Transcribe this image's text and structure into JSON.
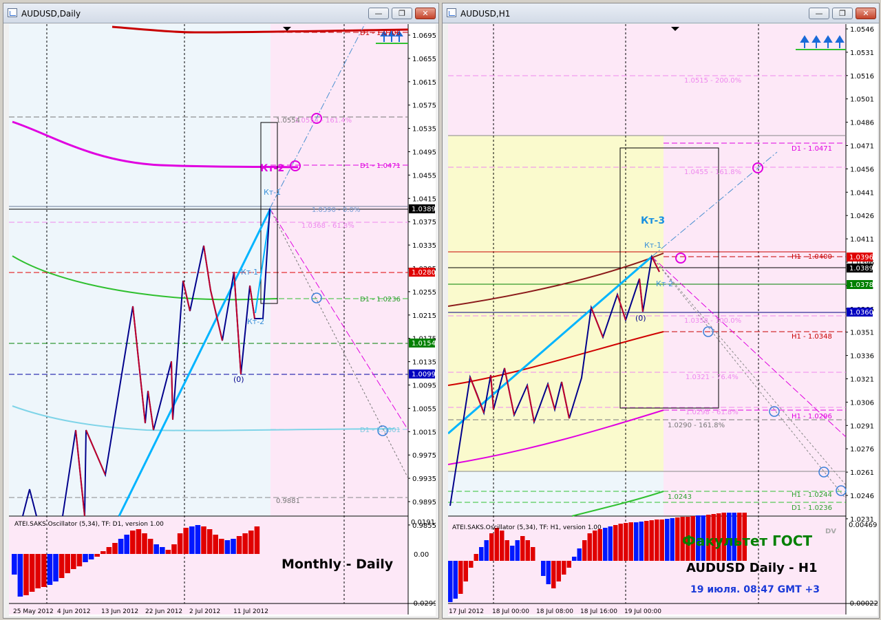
{
  "windows": {
    "left": {
      "title": "AUDUSD,Daily"
    },
    "right": {
      "title": "AUDUSD,H1"
    }
  },
  "controls": {
    "minimize": "—",
    "restore": "❐",
    "close": "✕"
  },
  "left_chart": {
    "price_ticks": [
      "1.0695",
      "1.0655",
      "1.0615",
      "1.0575",
      "1.0535",
      "1.0495",
      "1.0455",
      "1.0415",
      "1.0375",
      "1.0335",
      "1.0295",
      "1.0255",
      "1.0215",
      "1.0175",
      "1.0135",
      "1.0095",
      "1.0055",
      "1.0015",
      "0.9975",
      "0.9935",
      "0.9895",
      "0.9855"
    ],
    "price_boxes": [
      {
        "label": "1.0389",
        "color": "#000000"
      },
      {
        "label": "1.0280",
        "color": "#e00000"
      },
      {
        "label": "1.0154",
        "color": "#008000"
      },
      {
        "label": "1.0099",
        "color": "#0000c0"
      }
    ],
    "line_labels": {
      "d1_top": "D1 - 1.0706",
      "d1_mag": "D1 - 1.0471",
      "d1_green": "D1 - 1.0236",
      "d1_cyan": "D1 - 1.0001",
      "fib_1": "1.0554 - 161.4%",
      "fib_box": "1.0554",
      "fib_2": "1.0390 - 0.0%",
      "fib_3": "1.0368 - 61.8%",
      "low": "0.9881"
    },
    "wave_labels": {
      "kt2_big": "Кт-2",
      "kt1_top": "Кт-1",
      "kt1": "Кт-1",
      "kt2": "Кт-2",
      "zero": "(0)"
    },
    "date_ticks": [
      "25 May 2012",
      "4 Jun 2012",
      "13 Jun 2012",
      "22 Jun 2012",
      "2 Jul 2012",
      "11 Jul 2012"
    ],
    "oscillator": {
      "label": "ATEI.SAKS.Oscillator (5,34), TF: D1, version 1.00",
      "ticks": [
        "0.01918",
        "0.00",
        "-0.02998"
      ]
    },
    "overlay_text": "Monthly - Daily"
  },
  "right_chart": {
    "price_ticks": [
      "1.0546",
      "1.0531",
      "1.0516",
      "1.0501",
      "1.0486",
      "1.0471",
      "1.0456",
      "1.0441",
      "1.0426",
      "1.0411",
      "1.0396",
      "1.0381",
      "1.0366",
      "1.0351",
      "1.0336",
      "1.0321",
      "1.0306",
      "1.0291",
      "1.0276",
      "1.0261",
      "1.0246",
      "1.0231"
    ],
    "price_boxes": [
      {
        "label": "1.0396",
        "color": "#e00000"
      },
      {
        "label": "1.0389",
        "color": "#000000"
      },
      {
        "label": "1.0378",
        "color": "#008000"
      },
      {
        "label": "1.0360",
        "color": "#0000c0"
      }
    ],
    "line_labels": {
      "fib_200": "1.0515 - 200.0%",
      "d1_mag": "D1 - 1.0471",
      "fib_161": "1.0455 - 161.8%",
      "h1_top": "H1 - 1.0400",
      "fib_100": "1.0358 - 100.0%",
      "h1_red": "H1 - 1.0348",
      "fib_76": "1.0321 - 76.4%",
      "fib_61": "1.0298 - 61.8%",
      "h1_mag": "H1 - 1.0296",
      "fib_low": "1.0290 - 161.8%",
      "h1_green": "H1 - 1.0244",
      "d1_green": "D1 - 1.0236",
      "low": "1.0243"
    },
    "wave_labels": {
      "kt3": "Кт-3",
      "kt1": "Кт-1",
      "kt2": "Кт-2",
      "zero": "(0)"
    },
    "date_ticks": [
      "17 Jul 2012",
      "18 Jul 00:00",
      "18 Jul 08:00",
      "18 Jul 16:00",
      "19 Jul 00:00"
    ],
    "oscillator": {
      "label": "ATEI.SAKS.Oscillator (5,34), TF: H1, version 1.00",
      "ticks": [
        "0.00469",
        "-0.00022"
      ],
      "mark": "DV"
    },
    "overlay": {
      "school": "Факультет ГОСТ",
      "pair": "AUDUSD Daily - H1",
      "time": "19 июля. 08:47 GMT +3"
    }
  },
  "colors": {
    "bull": "#e00000",
    "bear": "#0018ff",
    "wave_up": "#00008b",
    "wave_down": "#c0002a",
    "trend": "#00b4ff",
    "magenta": "#e000e0"
  }
}
